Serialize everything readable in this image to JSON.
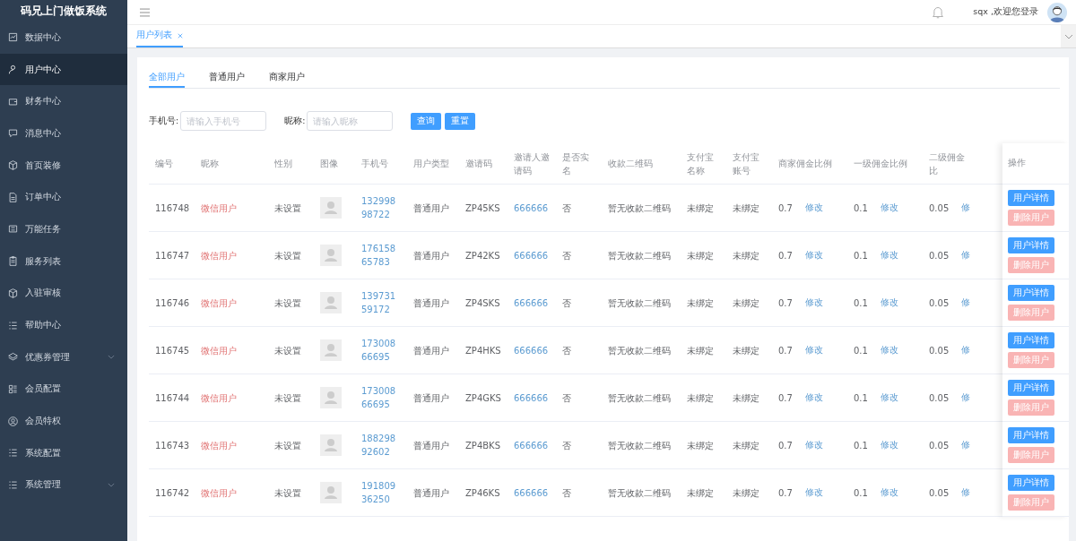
{
  "app_title": "码兄上门做饭系统",
  "sidebar": {
    "items": [
      {
        "label": "数据中心",
        "selected": false,
        "has_submenu": false
      },
      {
        "label": "用户中心",
        "selected": true,
        "has_submenu": false
      },
      {
        "label": "财务中心",
        "selected": false,
        "has_submenu": false
      },
      {
        "label": "消息中心",
        "selected": false,
        "has_submenu": false
      },
      {
        "label": "首页装修",
        "selected": false,
        "has_submenu": false
      },
      {
        "label": "订单中心",
        "selected": false,
        "has_submenu": false
      },
      {
        "label": "万能任务",
        "selected": false,
        "has_submenu": false
      },
      {
        "label": "服务列表",
        "selected": false,
        "has_submenu": false
      },
      {
        "label": "入驻审核",
        "selected": false,
        "has_submenu": false
      },
      {
        "label": "帮助中心",
        "selected": false,
        "has_submenu": false
      },
      {
        "label": "优惠券管理",
        "selected": false,
        "has_submenu": true
      },
      {
        "label": "会员配置",
        "selected": false,
        "has_submenu": false
      },
      {
        "label": "会员特权",
        "selected": false,
        "has_submenu": false
      },
      {
        "label": "系统配置",
        "selected": false,
        "has_submenu": false
      },
      {
        "label": "系统管理",
        "selected": false,
        "has_submenu": true
      }
    ]
  },
  "header": {
    "greeting": "sqx ,欢迎您登录"
  },
  "page_tabs": [
    {
      "label": "用户列表",
      "selected": true
    }
  ],
  "user_tabs": [
    {
      "label": "全部用户",
      "selected": true
    },
    {
      "label": "普通用户",
      "selected": false
    },
    {
      "label": "商家用户",
      "selected": false
    }
  ],
  "filters": [
    {
      "label": "手机号:",
      "placeholder": "请输入手机号"
    },
    {
      "label": "昵称:",
      "placeholder": "请输入昵称"
    }
  ],
  "filter_buttons": [
    "查询",
    "重置"
  ],
  "table": {
    "columns": [
      "编号",
      "昵称",
      "性别",
      "图像",
      "手机号",
      "用户类型",
      "邀请码",
      "邀请人邀请码",
      "是否实名",
      "收款二维码",
      "支付宝名称",
      "支付宝账号",
      "商家佣金比例",
      "一级佣金比例",
      "二级佣金比"
    ],
    "actions_heading": "操作",
    "rows": [
      {
        "id": "116748",
        "nickname": "微信用户",
        "gender": "未设置",
        "phone": "13299898722",
        "user_type": "普通用户",
        "invite_code": "ZP45KS",
        "inviter_code": "666666",
        "real_name": "否",
        "qr_code": "暂无收款二维码",
        "alipay_name": "未绑定",
        "alipay_account": "未绑定",
        "merchant_rate": "0.7",
        "level1_rate": "0.1",
        "level2_rate": "0.05",
        "merchant_edit": "修改",
        "level1_edit": "修改",
        "level2_edit": "修",
        "detail_button": "用户详情",
        "delete_button": "删除用户"
      },
      {
        "id": "116747",
        "nickname": "微信用户",
        "gender": "未设置",
        "phone": "17615865783",
        "user_type": "普通用户",
        "invite_code": "ZP42KS",
        "inviter_code": "666666",
        "real_name": "否",
        "qr_code": "暂无收款二维码",
        "alipay_name": "未绑定",
        "alipay_account": "未绑定",
        "merchant_rate": "0.7",
        "level1_rate": "0.1",
        "level2_rate": "0.05",
        "merchant_edit": "修改",
        "level1_edit": "修改",
        "level2_edit": "修",
        "detail_button": "用户详情",
        "delete_button": "删除用户"
      },
      {
        "id": "116746",
        "nickname": "微信用户",
        "gender": "未设置",
        "phone": "13973159172",
        "user_type": "普通用户",
        "invite_code": "ZP4SKS",
        "inviter_code": "666666",
        "real_name": "否",
        "qr_code": "暂无收款二维码",
        "alipay_name": "未绑定",
        "alipay_account": "未绑定",
        "merchant_rate": "0.7",
        "level1_rate": "0.1",
        "level2_rate": "0.05",
        "merchant_edit": "修改",
        "level1_edit": "修改",
        "level2_edit": "修",
        "detail_button": "用户详情",
        "delete_button": "删除用户"
      },
      {
        "id": "116745",
        "nickname": "微信用户",
        "gender": "未设置",
        "phone": "17300866695",
        "user_type": "普通用户",
        "invite_code": "ZP4HKS",
        "inviter_code": "666666",
        "real_name": "否",
        "qr_code": "暂无收款二维码",
        "alipay_name": "未绑定",
        "alipay_account": "未绑定",
        "merchant_rate": "0.7",
        "level1_rate": "0.1",
        "level2_rate": "0.05",
        "merchant_edit": "修改",
        "level1_edit": "修改",
        "level2_edit": "修",
        "detail_button": "用户详情",
        "delete_button": "删除用户"
      },
      {
        "id": "116744",
        "nickname": "微信用户",
        "gender": "未设置",
        "phone": "17300866695",
        "user_type": "普通用户",
        "invite_code": "ZP4GKS",
        "inviter_code": "666666",
        "real_name": "否",
        "qr_code": "暂无收款二维码",
        "alipay_name": "未绑定",
        "alipay_account": "未绑定",
        "merchant_rate": "0.7",
        "level1_rate": "0.1",
        "level2_rate": "0.05",
        "merchant_edit": "修改",
        "level1_edit": "修改",
        "level2_edit": "修",
        "detail_button": "用户详情",
        "delete_button": "删除用户"
      },
      {
        "id": "116743",
        "nickname": "微信用户",
        "gender": "未设置",
        "phone": "18829892602",
        "user_type": "普通用户",
        "invite_code": "ZP4BKS",
        "inviter_code": "666666",
        "real_name": "否",
        "qr_code": "暂无收款二维码",
        "alipay_name": "未绑定",
        "alipay_account": "未绑定",
        "merchant_rate": "0.7",
        "level1_rate": "0.1",
        "level2_rate": "0.05",
        "merchant_edit": "修改",
        "level1_edit": "修改",
        "level2_edit": "修",
        "detail_button": "用户详情",
        "delete_button": "删除用户"
      },
      {
        "id": "116742",
        "nickname": "微信用户",
        "gender": "未设置",
        "phone": "19180936250",
        "user_type": "普通用户",
        "invite_code": "ZP46KS",
        "inviter_code": "666666",
        "real_name": "否",
        "qr_code": "暂无收款二维码",
        "alipay_name": "未绑定",
        "alipay_account": "未绑定",
        "merchant_rate": "0.7",
        "level1_rate": "0.1",
        "level2_rate": "0.05",
        "merchant_edit": "修改",
        "level1_edit": "修改",
        "level2_edit": "修",
        "detail_button": "用户详情",
        "delete_button": "删除用户"
      }
    ]
  }
}
